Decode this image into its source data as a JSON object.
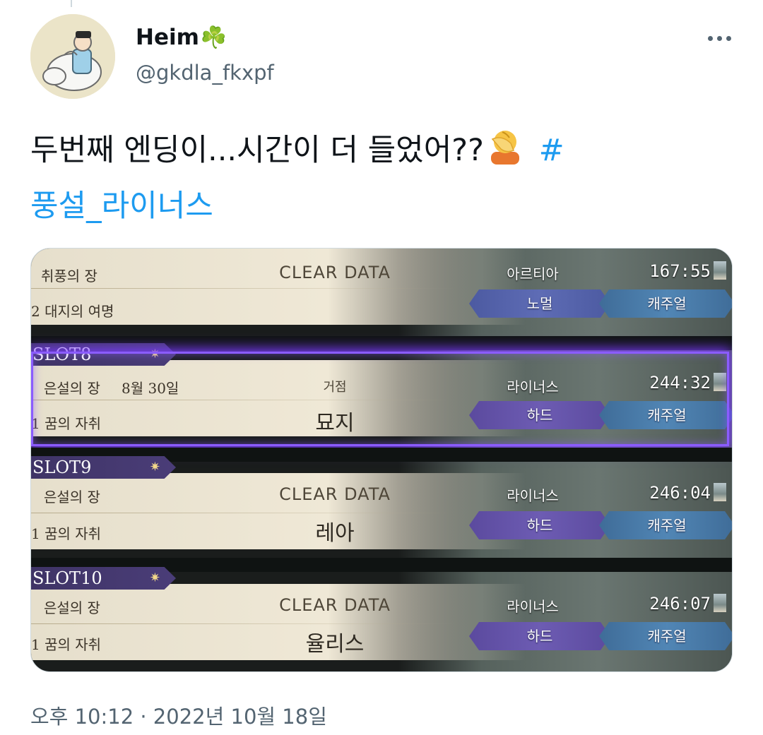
{
  "tweet": {
    "display_name": "Heim",
    "name_emoji": "☘️",
    "handle": "@gkdla_fkxpf",
    "text_main": "두번째 엔딩이...시간이 더 들었어??",
    "text_emoji": "facepalm-emoji",
    "hashtag_symbol": "#",
    "hashtag_text": "풍설_라이너스",
    "timestamp": "오후 10:12 · 2022년 10월 18일",
    "colors": {
      "link": "#1d9bf0",
      "muted": "#536471",
      "text": "#0f1419"
    }
  },
  "game": {
    "slots": [
      {
        "tag": "",
        "chapter": "취풍의 장",
        "subtitle": "2 대지의 여명",
        "date": "",
        "center_top": "CLEAR DATA",
        "center_bottom": "",
        "character": "아르티아",
        "time": "167:55",
        "difficulty": "노멀",
        "mode": "캐주얼",
        "selected": false
      },
      {
        "tag": "SLOT8",
        "chapter": "은설의 장",
        "subtitle": "1 꿈의 자취",
        "date": "8월 30일",
        "center_top": "거점",
        "center_bottom": "묘지",
        "character": "라이너스",
        "time": "244:32",
        "difficulty": "하드",
        "mode": "캐주얼",
        "selected": true
      },
      {
        "tag": "SLOT9",
        "chapter": "은설의 장",
        "subtitle": "1 꿈의 자취",
        "date": "",
        "center_top": "CLEAR DATA",
        "center_bottom": "레아",
        "character": "라이너스",
        "time": "246:04",
        "difficulty": "하드",
        "mode": "캐주얼",
        "selected": false
      },
      {
        "tag": "SLOT10",
        "chapter": "은설의 장",
        "subtitle": "1 꿈의 자취",
        "date": "",
        "center_top": "CLEAR DATA",
        "center_bottom": "율리스",
        "character": "라이너스",
        "time": "246:07",
        "difficulty": "하드",
        "mode": "캐주얼",
        "selected": false
      }
    ],
    "colors": {
      "selected_glow": "#8b5cff",
      "slot_tag": "#4a3d78",
      "difficulty_pill": "#5e6cb5",
      "mode_pill": "#5186b5"
    }
  }
}
